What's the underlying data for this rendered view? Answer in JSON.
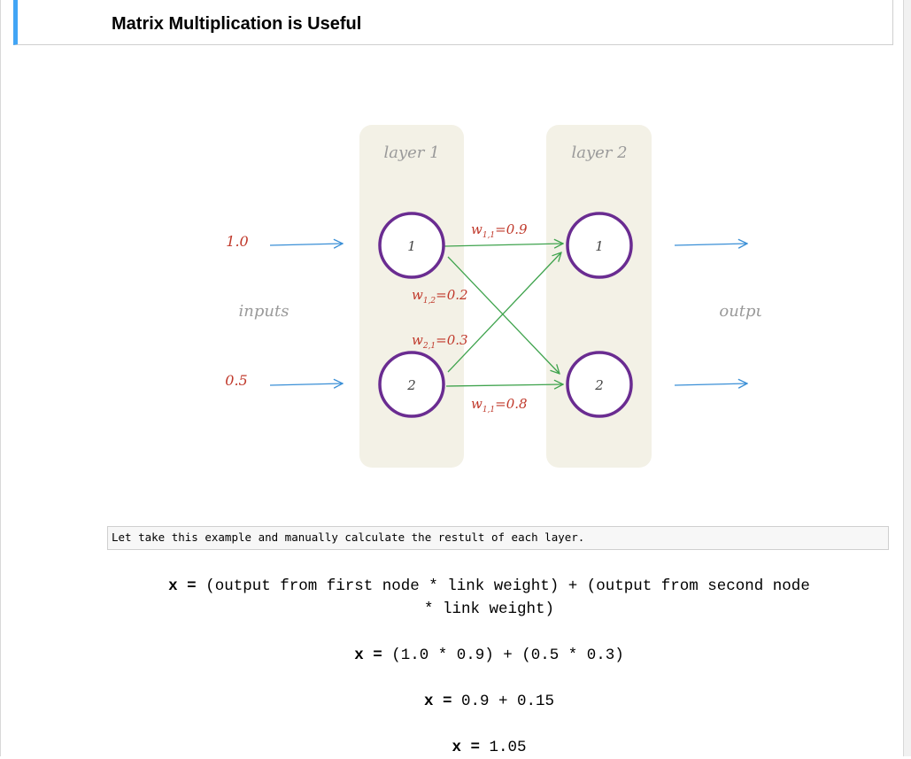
{
  "notebook": {
    "title": "Matrix Multiplication is Useful"
  },
  "figure": {
    "layer_labels": [
      "layer 1",
      "layer 2"
    ],
    "input_values": [
      "1.0",
      "0.5"
    ],
    "side_labels": {
      "inputs": "inputs",
      "outputs": "outputs"
    },
    "layer1_nodes": [
      "1",
      "2"
    ],
    "layer2_nodes": [
      "1",
      "2"
    ],
    "weights": {
      "w11": {
        "symbol": "w",
        "sub": "1,1",
        "value": "=0.9"
      },
      "w12": {
        "symbol": "w",
        "sub": "1,2",
        "value": "=0.2"
      },
      "w21": {
        "symbol": "w",
        "sub": "2,1",
        "value": "=0.3"
      },
      "w22": {
        "symbol": "w",
        "sub": "1,1",
        "value": "=0.8"
      }
    },
    "colors": {
      "input_text": "#c0392b",
      "arrow_blue": "#3a8fd6",
      "link_green": "#3fa34d",
      "node_ring": "#6a2c91",
      "layer_bg": "#f3f1e6",
      "label_gray": "#9a9a9a",
      "weight_red": "#c0392b"
    }
  },
  "code_cell": {
    "text": "Let take this example and manually calculate the restult of each layer."
  },
  "formulas": {
    "line1_var": "x =",
    "line1_rest": "(output from first node * link weight) + (output from second node",
    "line1_cont": "* link weight)",
    "line2_var": "x =",
    "line2_rest": "(1.0 * 0.9) + (0.5 * 0.3)",
    "line3_var": "x =",
    "line3_rest": "0.9 + 0.15",
    "line4_var": "x =",
    "line4_rest": "1.05"
  }
}
